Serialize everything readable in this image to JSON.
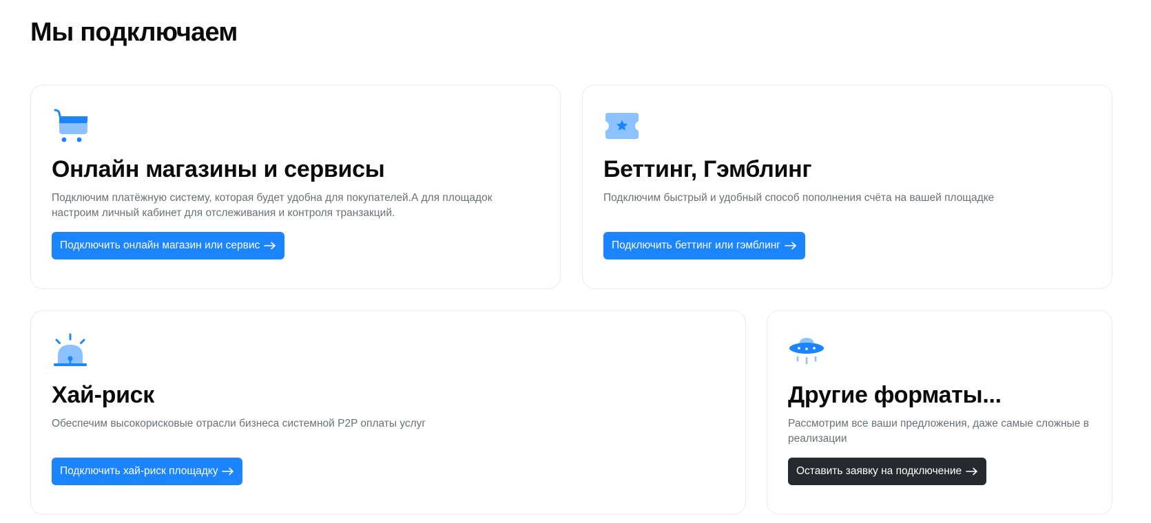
{
  "page": {
    "title": "Мы подключаем"
  },
  "colors": {
    "accent": "#1a85ff",
    "accent_light": "#8cc2ff",
    "dark_button": "#26292d",
    "muted_text": "#6b6f76",
    "card_border": "#e9ebee"
  },
  "cards": [
    {
      "icon": "shopping-cart-icon",
      "title": "Онлайн магазины и сервисы",
      "description": "Подключим платёжную систему, которая будет удобна для покупателей.А для площадок настроим личный кабинет для отслеживания и контроля транзакций.",
      "button_label": "Подключить онлайн магазин или сервис"
    },
    {
      "icon": "ticket-star-icon",
      "title": "Беттинг, Гэмблинг",
      "description": "Подключим быстрый и удобный способ пополнения счёта на вашей площадке",
      "button_label": "Подключить беттинг или гэмблинг"
    },
    {
      "icon": "siren-icon",
      "title": "Хай-риск",
      "description": "Обеспечим высокорисковые отрасли бизнеса системной P2P оплаты услуг",
      "button_label": "Подключить хай-риск площадку"
    },
    {
      "icon": "ufo-icon",
      "title": "Другие форматы...",
      "description": "Рассмотрим все ваши предложения, даже самые сложные в реализации",
      "button_label": "Оставить заявку на подключение"
    }
  ]
}
